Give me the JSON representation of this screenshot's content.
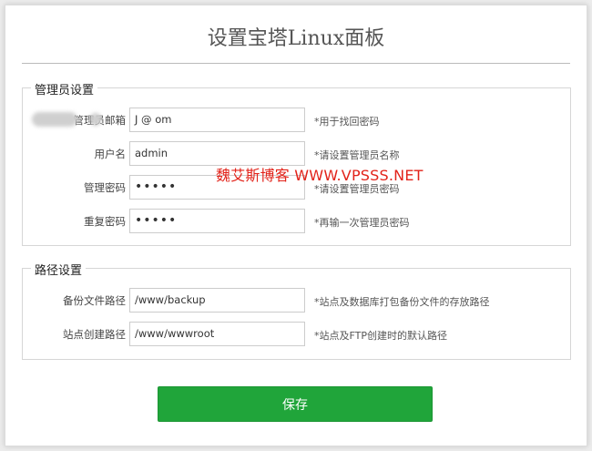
{
  "title": "设置宝塔Linux面板",
  "admin_section": {
    "legend": "管理员设置",
    "fields": [
      {
        "label": "管理员邮箱",
        "value": "J          @       om",
        "hint": "*用于找回密码"
      },
      {
        "label": "用户名",
        "value": "admin",
        "hint": "*请设置管理员名称"
      },
      {
        "label": "管理密码",
        "value": "•••••",
        "hint": "*请设置管理员密码"
      },
      {
        "label": "重复密码",
        "value": "•••••",
        "hint": "*再输一次管理员密码"
      }
    ]
  },
  "path_section": {
    "legend": "路径设置",
    "fields": [
      {
        "label": "备份文件路径",
        "value": "/www/backup",
        "hint": "*站点及数据库打包备份文件的存放路径"
      },
      {
        "label": "站点创建路径",
        "value": "/www/wwwroot",
        "hint": "*站点及FTP创建时的默认路径"
      }
    ]
  },
  "watermark": "魏艾斯博客 WWW.VPSSS.NET",
  "save_label": "保存",
  "colors": {
    "save_button": "#20a53a",
    "watermark": "#e2231a"
  }
}
